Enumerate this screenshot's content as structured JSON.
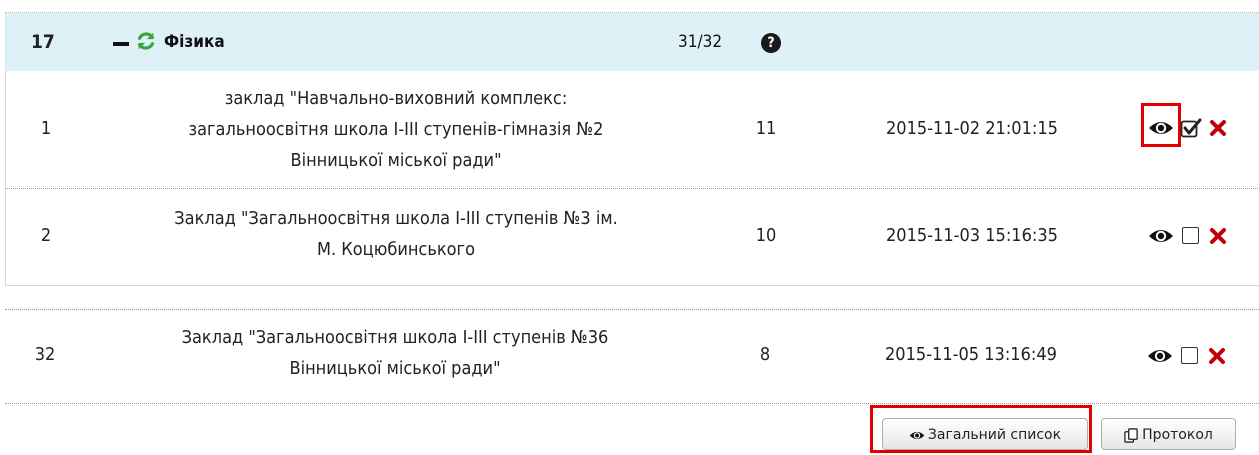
{
  "group": {
    "number": "17",
    "title": "Фізика",
    "count": "31/32",
    "help_icon": "?"
  },
  "rows": [
    {
      "num": "1",
      "name_lines": [
        "заклад \"Навчально-виховний комплекс:",
        "загальноосвітня школа І-ІІІ ступенів-гімназія №2",
        "Вінницької міської ради\""
      ],
      "score": "11",
      "datetime": "2015-11-02 21:01:15",
      "checked": true
    },
    {
      "num": "2",
      "name_lines": [
        "Заклад \"Загальноосвітня школа І-ІІІ ступенів №3 ім.",
        "М. Коцюбинського"
      ],
      "score": "10",
      "datetime": "2015-11-03 15:16:35",
      "checked": false
    },
    {
      "num": "32",
      "name_lines": [
        "Заклад \"Загальноосвітня школа І-ІІІ ступенів №36",
        "Вінницької міської ради\""
      ],
      "score": "8",
      "datetime": "2015-11-05 13:16:49",
      "checked": false
    }
  ],
  "buttons": {
    "general_list": "Загальний список",
    "protocol": "Протокол"
  },
  "colors": {
    "header_bg": "#def1f7",
    "refresh_green": "#3aa53a",
    "delete_red": "#c0000a",
    "highlight_red": "#e00000"
  }
}
